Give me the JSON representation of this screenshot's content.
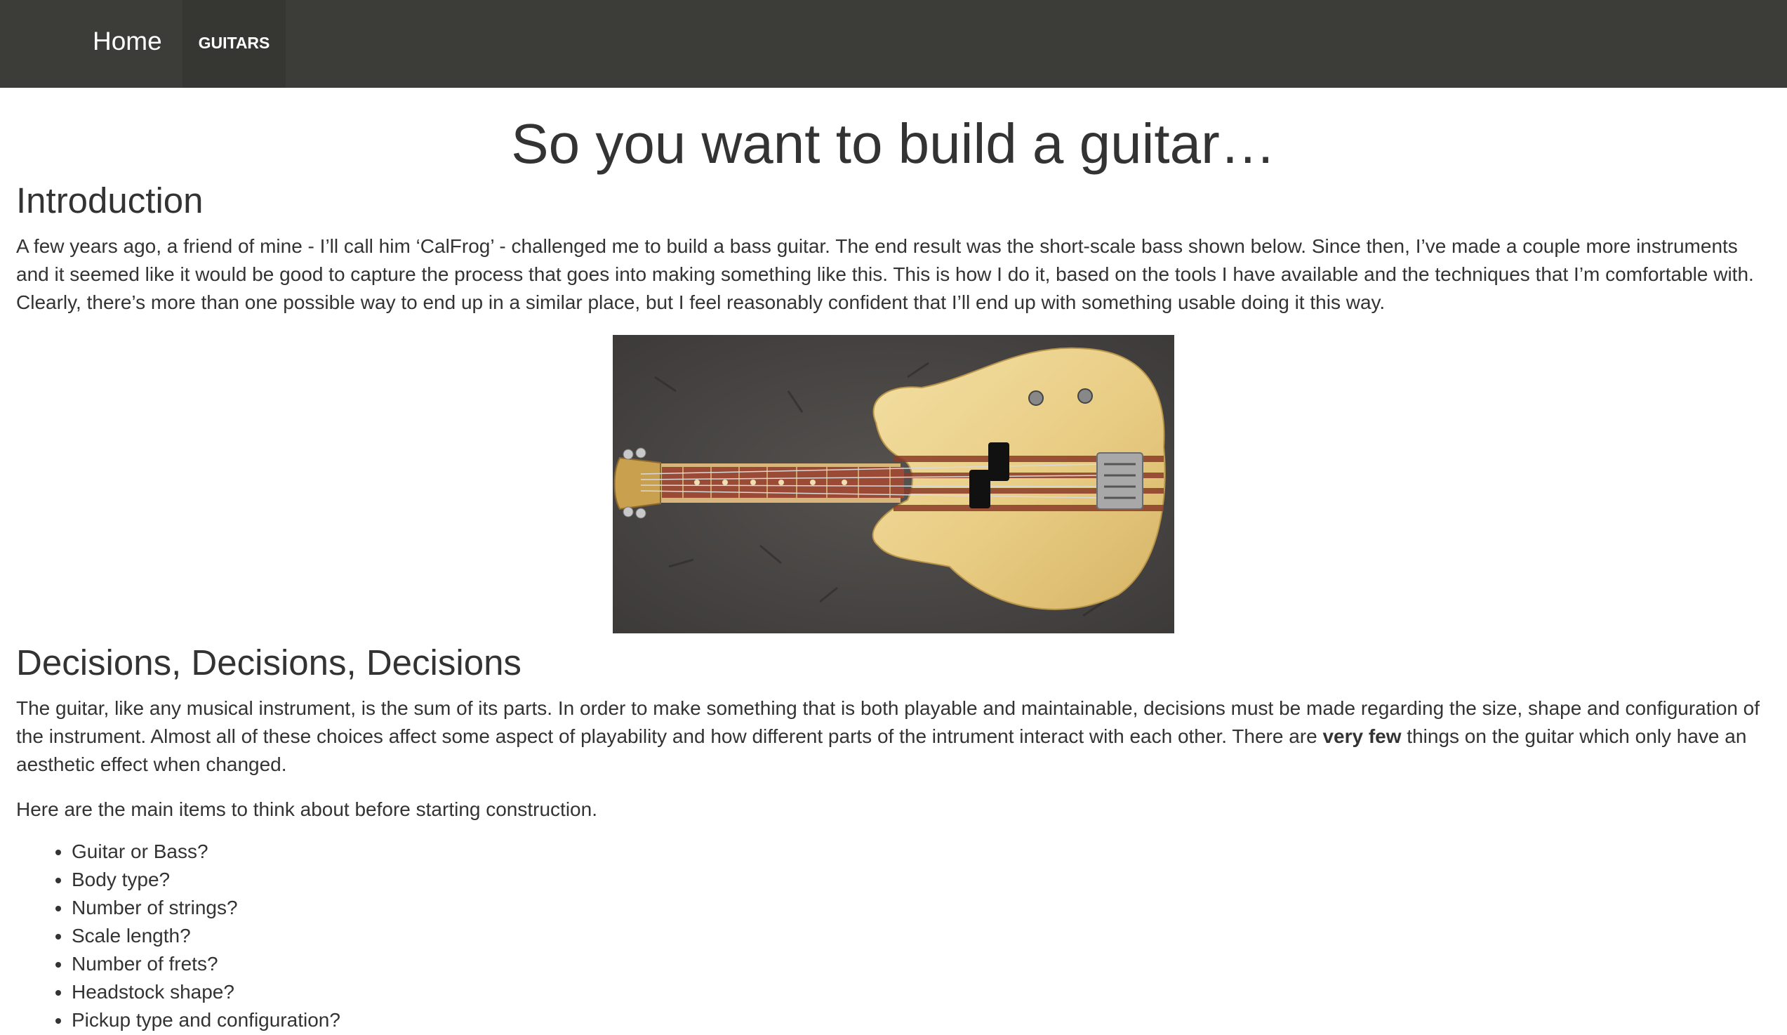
{
  "nav": {
    "brand": "Home",
    "items": [
      "GUITARS"
    ]
  },
  "article": {
    "title": "So you want to build a guitar…",
    "sections": [
      {
        "heading": "Introduction",
        "paragraph": "A few years ago, a friend of mine - I’ll call him ‘CalFrog’ - challenged me to build a bass guitar. The end result was the short-scale bass shown below. Since then, I’ve made a couple more instruments and it seemed like it would be good to capture the process that goes into making something like this. This is how I do it, based on the tools I have available and the techniques that I’m comfortable with. Clearly, there’s more than one possible way to end up in a similar place, but I feel reasonably confident that I’ll end up with something usable doing it this way."
      },
      {
        "heading": "Decisions, Decisions, Decisions",
        "paragraph_before_bold": "The guitar, like any musical instrument, is the sum of its parts. In order to make something that is both playable and maintainable, decisions must be made regarding the size, shape and configuration of the instrument. Almost all of these choices affect some aspect of playability and how different parts of the intrument interact with each other. There are ",
        "paragraph_bold": "very few",
        "paragraph_after_bold": " things on the guitar which only have an aesthetic effect when changed.",
        "lead_in": "Here are the main items to think about before starting construction.",
        "items": [
          "Guitar or Bass?",
          "Body type?",
          "Number of strings?",
          "Scale length?",
          "Number of frets?",
          "Headstock shape?",
          "Pickup type and configuration?"
        ]
      }
    ]
  },
  "colors": {
    "navbar": "#3c3d38",
    "nav_active": "#363732",
    "text": "#333333",
    "background": "#ffffff"
  }
}
